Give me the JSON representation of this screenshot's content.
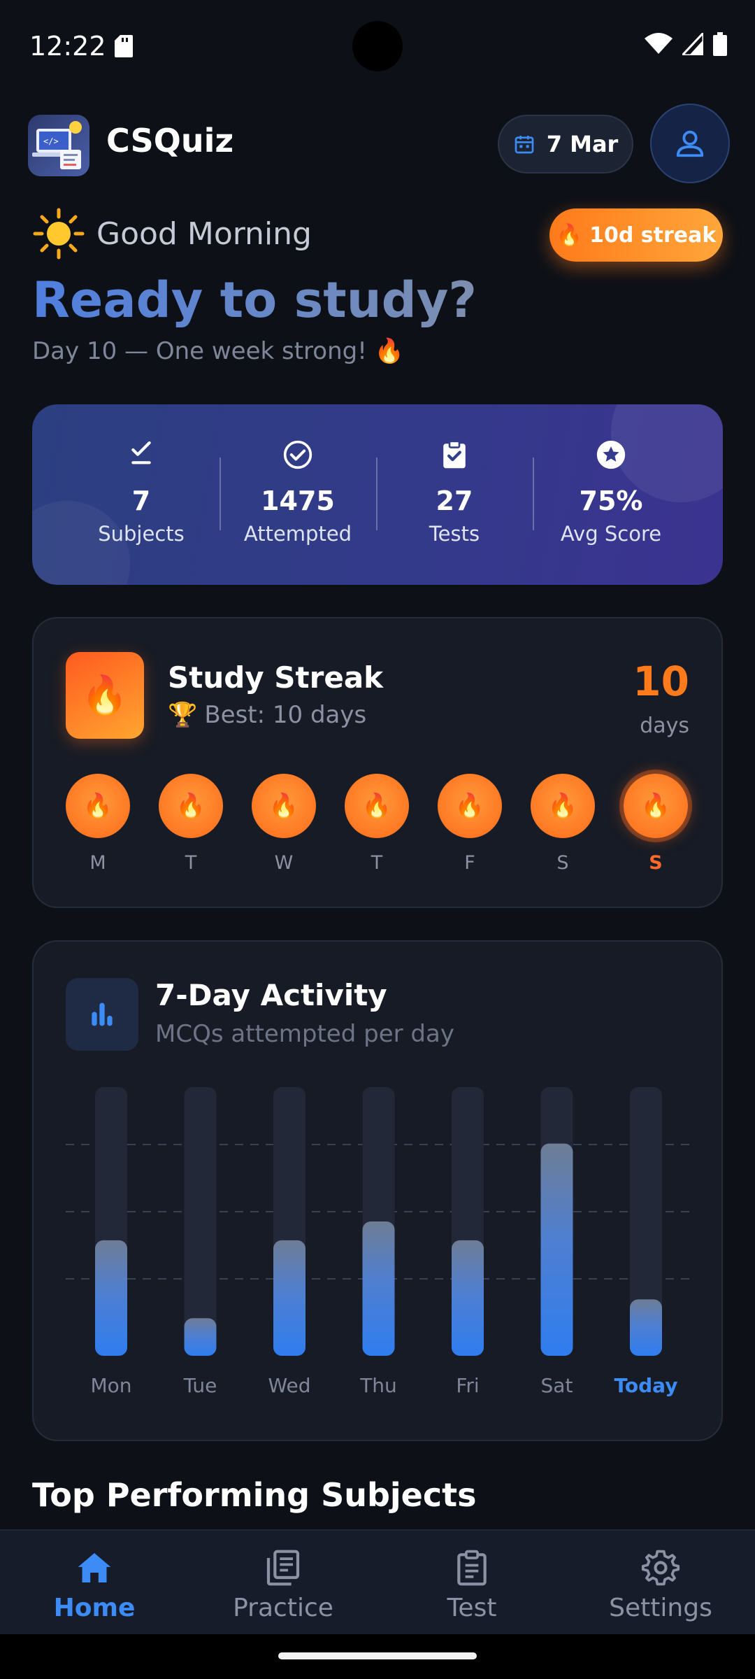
{
  "status_bar": {
    "time": "12:22"
  },
  "header": {
    "app_name": "CSQuiz",
    "date": "7 Mar"
  },
  "greeting": {
    "text": "Good Morning",
    "emoji": "☀️",
    "streak_badge": "10d streak",
    "headline": "Ready to study?",
    "subline": "Day 10 — One week strong! 🔥"
  },
  "stats": [
    {
      "icon": "checklist-icon",
      "value": "7",
      "label": "Subjects"
    },
    {
      "icon": "check-circle-icon",
      "value": "1475",
      "label": "Attempted"
    },
    {
      "icon": "clipboard-check-icon",
      "value": "27",
      "label": "Tests"
    },
    {
      "icon": "star-badge-icon",
      "value": "75%",
      "label": "Avg Score"
    }
  ],
  "streak": {
    "title": "Study Streak",
    "best": "Best: 10 days",
    "count": "10",
    "unit": "days",
    "days": [
      "M",
      "T",
      "W",
      "T",
      "F",
      "S",
      "S"
    ],
    "today_index": 6
  },
  "activity": {
    "title": "7-Day Activity",
    "subtitle": "MCQs attempted per day"
  },
  "chart_data": {
    "type": "bar",
    "categories": [
      "Mon",
      "Tue",
      "Wed",
      "Thu",
      "Fri",
      "Sat",
      "Today"
    ],
    "values": [
      0.43,
      0.14,
      0.43,
      0.5,
      0.43,
      0.79,
      0.21
    ],
    "value_unit": "fraction of max",
    "highlight": "Today",
    "grid": "dashed horizontal",
    "colors": {
      "bar_bottom": "#2f7df0",
      "bar_top": "#6e7d96",
      "track": "#222837"
    }
  },
  "sections": {
    "top_subjects": "Top Performing Subjects"
  },
  "nav": [
    {
      "label": "Home",
      "icon": "home-icon",
      "active": true
    },
    {
      "label": "Practice",
      "icon": "practice-icon",
      "active": false
    },
    {
      "label": "Test",
      "icon": "test-clipboard-icon",
      "active": false
    },
    {
      "label": "Settings",
      "icon": "settings-icon",
      "active": false
    }
  ],
  "colors": {
    "accent": "#3d8bf5",
    "streak": "#ff7a1a",
    "background": "#0d1017",
    "card": "#171b25"
  }
}
